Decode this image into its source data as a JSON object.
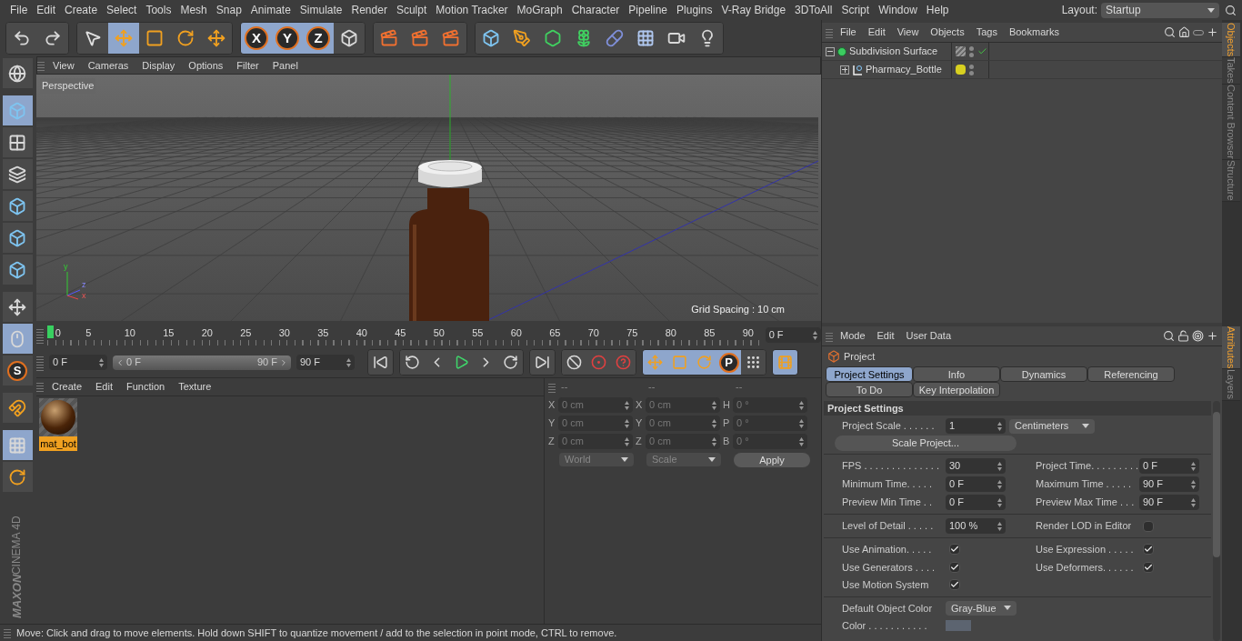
{
  "menu_bar": {
    "items": [
      "File",
      "Edit",
      "Create",
      "Select",
      "Tools",
      "Mesh",
      "Snap",
      "Animate",
      "Simulate",
      "Render",
      "Sculpt",
      "Motion Tracker",
      "MoGraph",
      "Character",
      "Pipeline",
      "Plugins",
      "V-Ray Bridge",
      "3DToAll",
      "Script",
      "Window",
      "Help"
    ],
    "layout_label": "Layout:",
    "layout_value": "Startup"
  },
  "toolbar": {
    "groups": [
      [
        {
          "kind": "undo",
          "selected": false
        },
        {
          "kind": "redo",
          "selected": false
        }
      ],
      [
        {
          "kind": "cursor",
          "selected": false
        },
        {
          "kind": "move",
          "selected": true
        },
        {
          "kind": "scale",
          "selected": false
        },
        {
          "kind": "rotate",
          "selected": false
        },
        {
          "kind": "move",
          "selected": false
        }
      ],
      [
        {
          "kind": "axis",
          "label": "X",
          "selected": true
        },
        {
          "kind": "axis",
          "label": "Y",
          "selected": true
        },
        {
          "kind": "axis",
          "label": "Z",
          "selected": true
        },
        {
          "kind": "coords",
          "selected": false
        }
      ],
      [
        {
          "kind": "clapper",
          "selected": false
        },
        {
          "kind": "clapper",
          "selected": false
        },
        {
          "kind": "clapper",
          "selected": false
        }
      ],
      [
        {
          "kind": "cube",
          "selected": false
        },
        {
          "kind": "pen",
          "selected": false
        },
        {
          "kind": "hexagon",
          "selected": false
        },
        {
          "kind": "flower",
          "selected": false
        },
        {
          "kind": "pill",
          "selected": false
        },
        {
          "kind": "floor",
          "selected": false
        },
        {
          "kind": "camera",
          "selected": false
        },
        {
          "kind": "light",
          "selected": false
        }
      ]
    ]
  },
  "left_toolbar": {
    "groups": [
      [
        {
          "kind": "globe",
          "selected": false
        }
      ],
      [
        {
          "kind": "cube",
          "selected": true
        },
        {
          "kind": "checker",
          "selected": false
        },
        {
          "kind": "layers",
          "selected": false
        },
        {
          "kind": "cube",
          "selected": false
        },
        {
          "kind": "cube",
          "selected": false
        },
        {
          "kind": "cube",
          "selected": false
        }
      ],
      [
        {
          "kind": "axis",
          "selected": false
        },
        {
          "kind": "mouse",
          "selected": true
        },
        {
          "kind": "letter",
          "label": "S",
          "selected": false
        }
      ],
      [
        {
          "kind": "magnet",
          "selected": false
        }
      ],
      [
        {
          "kind": "gridlock",
          "selected": true
        },
        {
          "kind": "gridrotate",
          "selected": false
        }
      ]
    ]
  },
  "logo": {
    "brand": "MAXON",
    "product": "CINEMA 4D"
  },
  "viewport": {
    "menu": [
      "View",
      "Cameras",
      "Display",
      "Options",
      "Filter",
      "Panel"
    ],
    "camera": "Perspective",
    "grid_spacing": "Grid Spacing : 10 cm",
    "axis_labels": [
      "y",
      "z",
      "x"
    ]
  },
  "timeline": {
    "ticks": [
      "0",
      "5",
      "10",
      "15",
      "20",
      "25",
      "30",
      "35",
      "40",
      "45",
      "50",
      "55",
      "60",
      "65",
      "70",
      "75",
      "80",
      "85",
      "90"
    ],
    "current_frame": "0 F",
    "start": "0 F",
    "range_start": "0 F",
    "range_end": "90 F",
    "range_slider": {
      "level": 1
    },
    "end": "90 F",
    "tool_groups": [
      [
        {
          "kind": "first",
          "selected": false
        }
      ],
      [
        {
          "kind": "loopback",
          "selected": false
        },
        {
          "kind": "prevkey",
          "selected": false
        },
        {
          "kind": "play",
          "selected": false
        },
        {
          "kind": "nextkey",
          "selected": false
        },
        {
          "kind": "loopfwd",
          "selected": false
        }
      ],
      [
        {
          "kind": "last",
          "selected": false
        }
      ],
      [
        {
          "kind": "keyoff",
          "selected": false
        },
        {
          "kind": "record",
          "selected": false
        },
        {
          "kind": "help",
          "selected": false
        }
      ],
      [
        {
          "kind": "move",
          "selected": true
        },
        {
          "kind": "scale",
          "selected": true
        },
        {
          "kind": "rotate",
          "selected": true
        },
        {
          "kind": "letter",
          "label": "P",
          "selected": true
        },
        {
          "kind": "dots",
          "selected": false
        }
      ],
      [
        {
          "kind": "film",
          "selected": true
        }
      ]
    ]
  },
  "material_manager": {
    "menu": [
      "Create",
      "Edit",
      "Function",
      "Texture"
    ],
    "materials": [
      {
        "name": "mat_bot",
        "selected": true
      }
    ]
  },
  "coordinates": {
    "headers": [
      "--",
      "--",
      "--"
    ],
    "rows": [
      [
        {
          "axis": "X",
          "value": "0 cm"
        },
        {
          "axis": "X",
          "value": "0 cm"
        },
        {
          "axis": "H",
          "value": "0 °"
        }
      ],
      [
        {
          "axis": "Y",
          "value": "0 cm"
        },
        {
          "axis": "Y",
          "value": "0 cm"
        },
        {
          "axis": "P",
          "value": "0 °"
        }
      ],
      [
        {
          "axis": "Z",
          "value": "0 cm"
        },
        {
          "axis": "Z",
          "value": "0 cm"
        },
        {
          "axis": "B",
          "value": "0 °"
        }
      ]
    ],
    "disabled": true,
    "dropdowns": [
      "World",
      "Scale"
    ],
    "apply": "Apply"
  },
  "status_bar": "Move: Click and drag to move elements. Hold down SHIFT to quantize movement / add to the selection in point mode, CTRL to remove.",
  "object_manager": {
    "menu": [
      "File",
      "Edit",
      "View",
      "Objects",
      "Tags",
      "Bookmarks"
    ],
    "objects": [
      {
        "name": "Subdivision Surface",
        "kind": "subdivision",
        "expanded": true,
        "enabled": true,
        "children": [
          {
            "name": "Pharmacy_Bottle",
            "kind": "null",
            "expanded": false,
            "enabled": false,
            "color": "#d8d020"
          }
        ]
      }
    ]
  },
  "side_tabs_top": [
    {
      "label": "Objects",
      "selected": true
    },
    {
      "label": "Takes",
      "selected": false
    },
    {
      "label": "Content Browser",
      "selected": false
    },
    {
      "label": "Structure",
      "selected": false
    }
  ],
  "side_tabs_bottom": [
    {
      "label": "Attributes",
      "selected": true
    },
    {
      "label": "Layers",
      "selected": false
    }
  ],
  "attributes": {
    "menu": [
      "Mode",
      "Edit",
      "User Data"
    ],
    "object": "Project",
    "tabs": [
      {
        "label": "Project Settings",
        "selected": true
      },
      {
        "label": "Info",
        "selected": false
      },
      {
        "label": "Dynamics",
        "selected": false
      },
      {
        "label": "Referencing",
        "selected": false
      },
      {
        "label": "To Do",
        "selected": false
      },
      {
        "label": "Key Interpolation",
        "selected": false
      }
    ],
    "section": "Project Settings",
    "project_scale": {
      "label": "Project Scale . . . . . .",
      "value": "1",
      "unit": "Centimeters"
    },
    "scale_button": "Scale Project...",
    "groups": [
      [
        {
          "kind": "number",
          "label": "FPS . . . . . . . . . . . . . .",
          "value": "30"
        },
        {
          "kind": "number",
          "label": "Project Time. . . . . . . . .",
          "value": "0 F"
        },
        {
          "kind": "number",
          "label": "Minimum Time. . . . .",
          "value": "0 F"
        },
        {
          "kind": "number",
          "label": "Maximum Time . . . . .",
          "value": "90 F"
        },
        {
          "kind": "number",
          "label": "Preview Min Time . .",
          "value": "0 F"
        },
        {
          "kind": "number",
          "label": "Preview Max Time . . .",
          "value": "90 F"
        }
      ],
      [
        {
          "kind": "number",
          "label": "Level of Detail . . . . .",
          "value": "100 %"
        },
        {
          "kind": "checkbox",
          "label": "Render LOD in Editor",
          "checked": false
        }
      ],
      [
        {
          "kind": "checkbox",
          "label": "Use Animation. . . . .",
          "checked": true
        },
        {
          "kind": "checkbox",
          "label": "Use Expression . . . . .",
          "checked": true
        },
        {
          "kind": "checkbox",
          "label": "Use Generators . . . .",
          "checked": true
        },
        {
          "kind": "checkbox",
          "label": "Use Deformers. . . . . .",
          "checked": true
        },
        {
          "kind": "checkbox",
          "label": "Use Motion System",
          "checked": true
        }
      ]
    ],
    "default_color": {
      "label": "Default Object Color",
      "value": "Gray-Blue"
    },
    "color": {
      "label": "Color . . . . . . . . . . ."
    }
  }
}
